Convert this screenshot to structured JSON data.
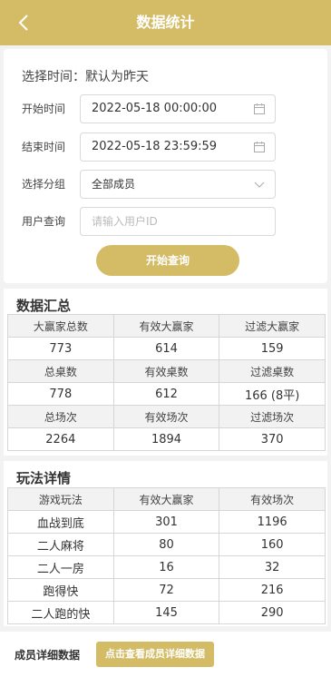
{
  "header": {
    "title": "数据统计"
  },
  "filter": {
    "select_time_label": "选择时间：默认为昨天",
    "start_label": "开始时间",
    "start_value": "2022-05-18 00:00:00",
    "end_label": "结束时间",
    "end_value": "2022-05-18 23:59:59",
    "group_label": "选择分组",
    "group_value": "全部成员",
    "user_label": "用户查询",
    "user_placeholder": "请输入用户ID",
    "query_button": "开始查询"
  },
  "summary": {
    "title": "数据汇总",
    "rows": [
      [
        "大赢家总数",
        "有效大赢家",
        "过滤大赢家"
      ],
      [
        "773",
        "614",
        "159"
      ],
      [
        "总桌数",
        "有效桌数",
        "过滤桌数"
      ],
      [
        "778",
        "612",
        "166 (8平)"
      ],
      [
        "总场次",
        "有效场次",
        "过滤场次"
      ],
      [
        "2264",
        "1894",
        "370"
      ]
    ]
  },
  "gameplay": {
    "title": "玩法详情",
    "headers": [
      "游戏玩法",
      "有效大赢家",
      "有效场次"
    ],
    "rows": [
      [
        "血战到底",
        "301",
        "1196"
      ],
      [
        "二人麻将",
        "80",
        "160"
      ],
      [
        "二人一房",
        "16",
        "32"
      ],
      [
        "跑得快",
        "72",
        "216"
      ],
      [
        "二人跑的快",
        "145",
        "290"
      ]
    ]
  },
  "footer": {
    "label": "成员详细数据",
    "button": "点击查看成员详细数据"
  },
  "colors": {
    "accent": "#d4bc66",
    "border": "#d6d6d6",
    "header_cell": "#f2f2f2"
  }
}
